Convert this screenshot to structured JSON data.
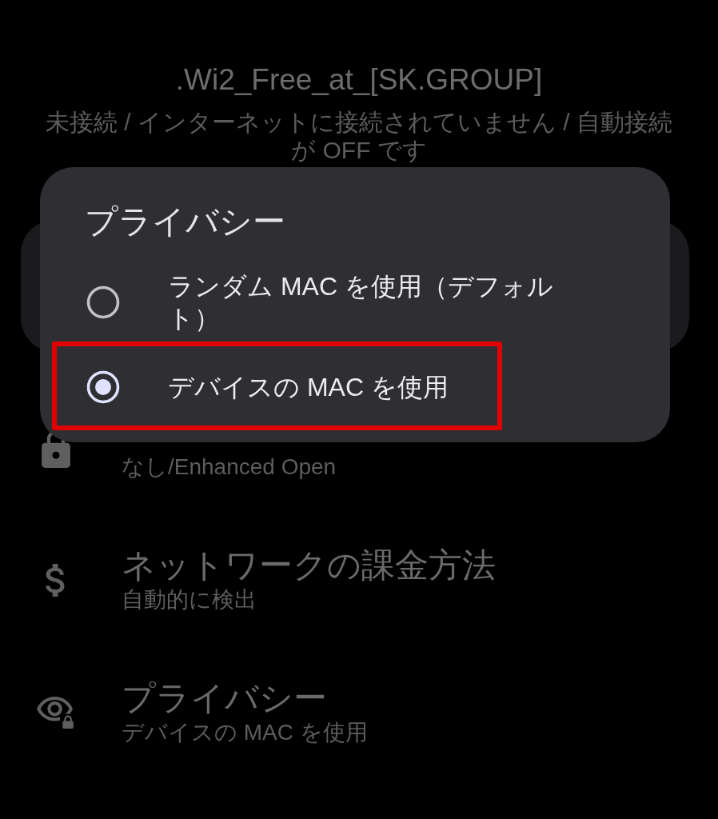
{
  "header": {
    "title": ".Wi2_Free_at_[SK.GROUP]",
    "status": "未接続 / インターネットに接続されていません / 自動接続が OFF です"
  },
  "settings": [
    {
      "kind": "lock",
      "subtitle": "なし/Enhanced Open"
    },
    {
      "kind": "dollar",
      "title": "ネットワークの課金方法",
      "subtitle": "自動的に検出"
    },
    {
      "kind": "eye",
      "title": "プライバシー",
      "subtitle": "デバイスの MAC を使用"
    }
  ],
  "dialog": {
    "title": "プライバシー",
    "options": [
      {
        "label": "ランダム MAC を使用（デフォルト）",
        "selected": false,
        "highlighted": false
      },
      {
        "label": "デバイスの MAC を使用",
        "selected": true,
        "highlighted": true
      }
    ]
  }
}
